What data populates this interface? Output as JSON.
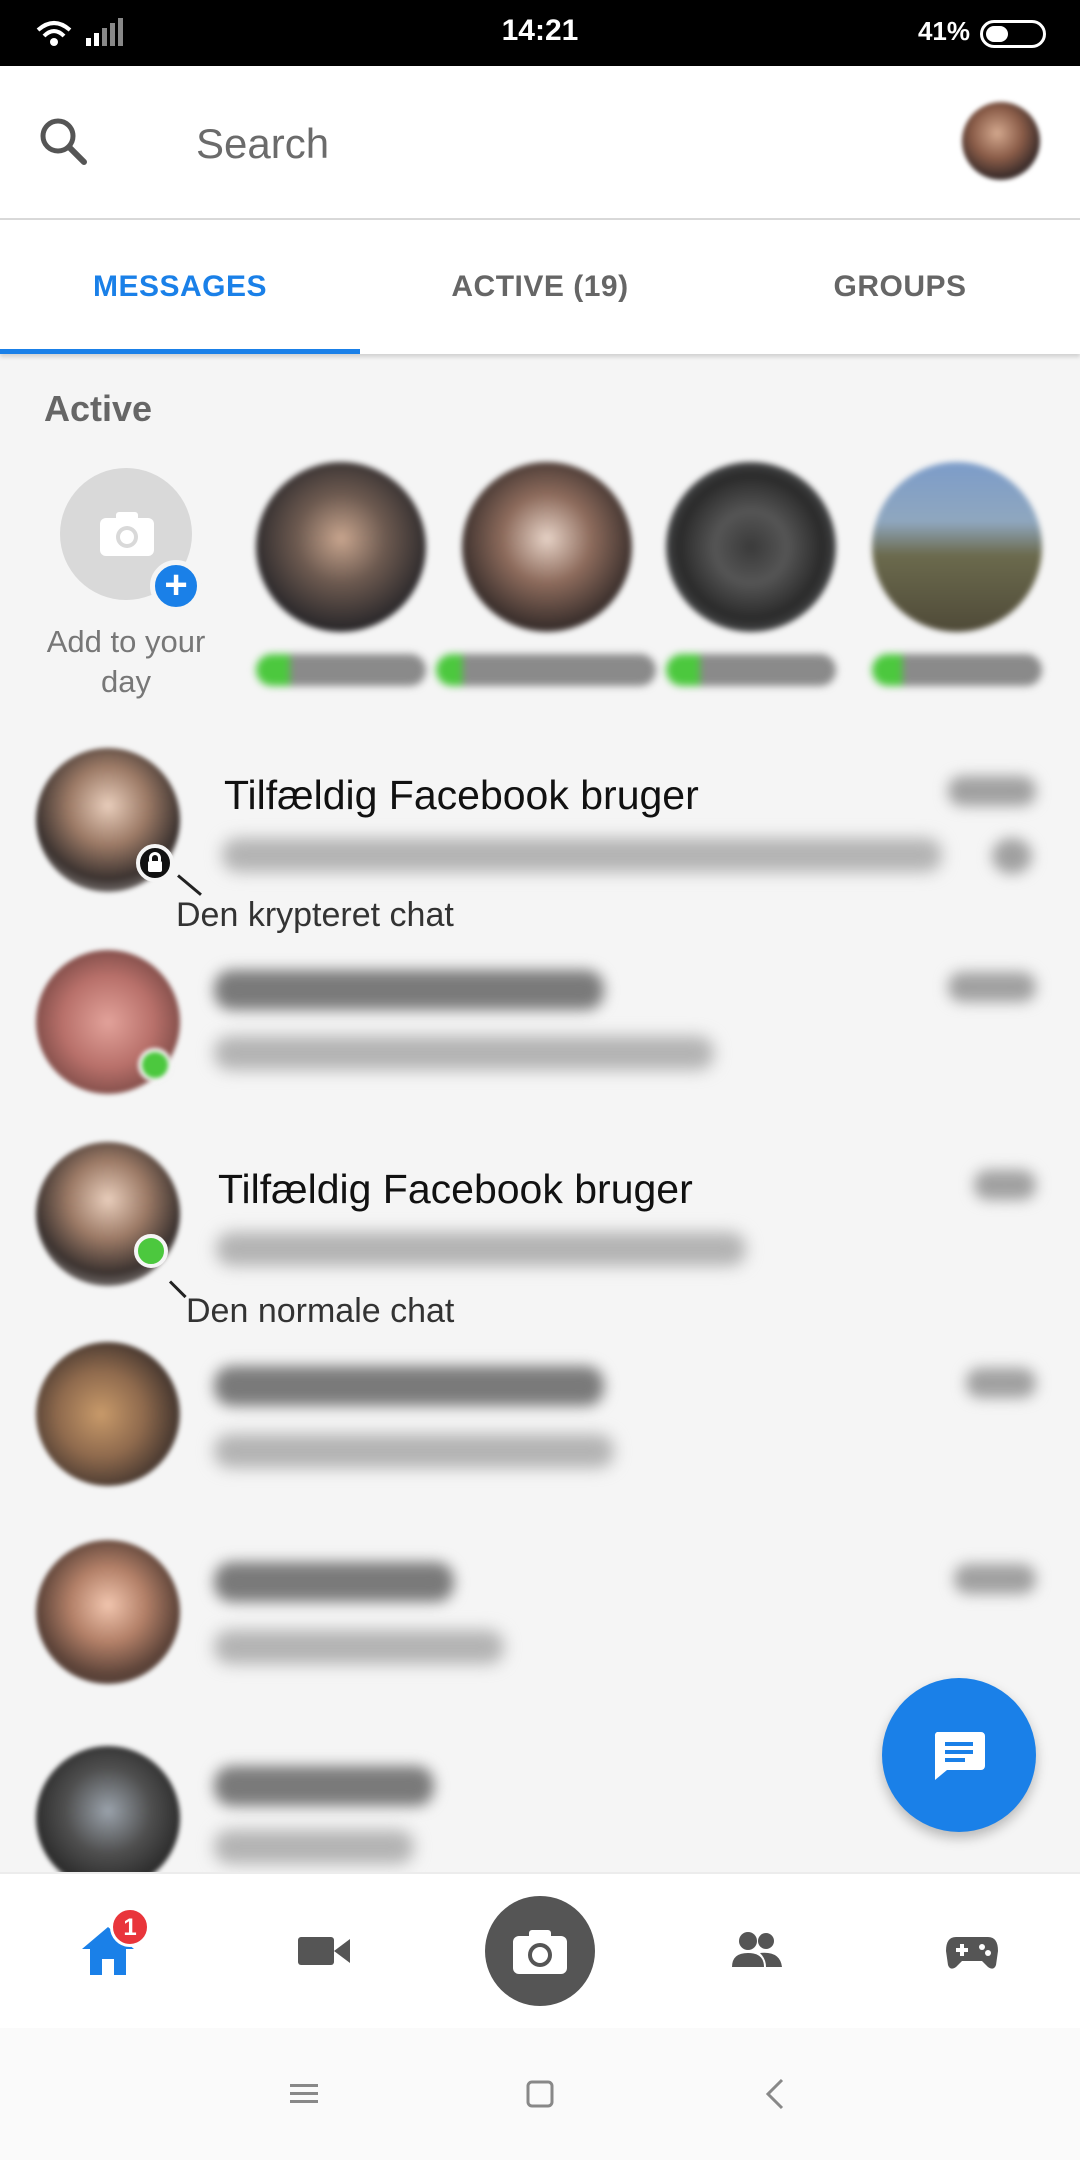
{
  "status_bar": {
    "time": "14:21",
    "battery": "41%"
  },
  "search": {
    "placeholder": "Search"
  },
  "tabs": [
    {
      "label": "MESSAGES",
      "active": true
    },
    {
      "label": "ACTIVE (19)",
      "active": false
    },
    {
      "label": "GROUPS",
      "active": false
    }
  ],
  "active_section": {
    "heading": "Active",
    "add_story_label": "Add to your day"
  },
  "conversations": [
    {
      "name": "Tilfældig Facebook bruger",
      "annotation": "Den krypteret chat",
      "badge": "lock-icon"
    },
    {
      "badge": "online"
    },
    {
      "name": "Tilfældig Facebook bruger",
      "annotation": "Den normale chat",
      "badge": "online"
    },
    {},
    {},
    {}
  ],
  "bottom_nav": {
    "items": [
      "home-icon",
      "video-camera-icon",
      "camera-icon",
      "people-icon",
      "game-controller-icon"
    ],
    "home_badge": "1"
  },
  "colors": {
    "accent": "#1a80e8",
    "online": "#4cc83e",
    "badge": "#e9353b"
  }
}
